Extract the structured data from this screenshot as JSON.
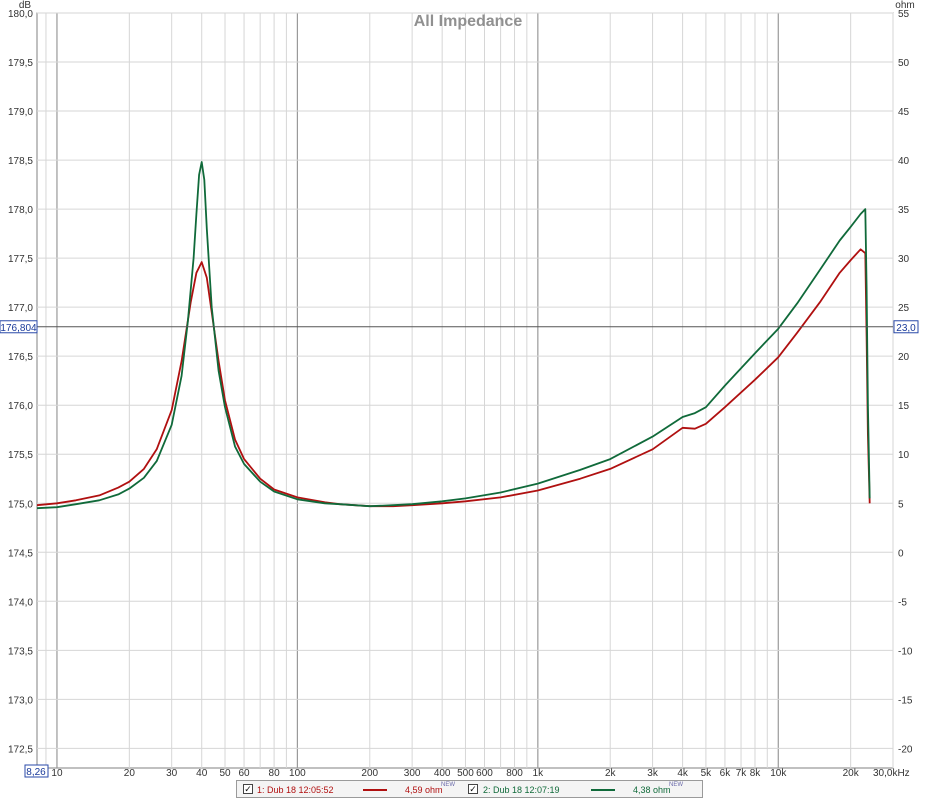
{
  "chart_data": {
    "type": "line",
    "title": "All Impedance",
    "x_scale": "log",
    "xlim": [
      8.26,
      30000
    ],
    "x_ticks": [
      10,
      20,
      30,
      40,
      50,
      60,
      80,
      100,
      200,
      300,
      400,
      500,
      600,
      800,
      1000,
      2000,
      3000,
      4000,
      5000,
      6000,
      7000,
      8000,
      10000,
      20000,
      30000
    ],
    "x_tick_labels": [
      "10",
      "20",
      "30",
      "40",
      "50",
      "60",
      "80",
      "100",
      "200",
      "300",
      "400",
      "500",
      "600",
      "800",
      "1k",
      "2k",
      "3k",
      "4k",
      "5k",
      "6k",
      "7k",
      "8k",
      "10k",
      "20k",
      "30,0kHz"
    ],
    "x_start_label": "8,26",
    "y_left_unit": "dB",
    "ylim_left": [
      172.3,
      180.0
    ],
    "y_left_ticks": [
      172.5,
      173.0,
      173.5,
      174.0,
      174.5,
      175.0,
      175.5,
      176.0,
      176.5,
      177.0,
      177.5,
      178.0,
      178.5,
      179.0,
      179.5,
      180.0
    ],
    "y_left_tick_labels": [
      "172,5",
      "173,0",
      "173,5",
      "174,0",
      "174,5",
      "175,0",
      "175,5",
      "176,0",
      "176,5",
      "177,0",
      "177,5",
      "178,0",
      "178,5",
      "179,0",
      "179,5",
      "180,0"
    ],
    "y_right_unit": "ohm",
    "ylim_right": [
      -22,
      55
    ],
    "y_right_ticks": [
      -20,
      -15,
      -10,
      -5,
      0,
      5,
      10,
      15,
      20,
      25,
      30,
      35,
      40,
      45,
      50,
      55
    ],
    "cursor": {
      "left_label": "176,804",
      "right_label": "23,0",
      "ohm": 23.0
    },
    "grid": true,
    "series": [
      {
        "name": "1: Dub 18 12:05:52",
        "value_label": "4,59 ohm",
        "color": "#b01010",
        "x": [
          8.26,
          10,
          12,
          15,
          18,
          20,
          23,
          26,
          30,
          33,
          36,
          38,
          40,
          42,
          44,
          47,
          50,
          55,
          60,
          70,
          80,
          100,
          130,
          150,
          200,
          250,
          300,
          400,
          500,
          700,
          1000,
          1500,
          2000,
          3000,
          4000,
          4500,
          5000,
          6000,
          8000,
          10000,
          12000,
          15000,
          18000,
          20000,
          22000,
          23000,
          23300,
          23600,
          24000
        ],
        "y": [
          4.8,
          5.0,
          5.3,
          5.8,
          6.6,
          7.2,
          8.5,
          10.5,
          14.5,
          19.5,
          25.5,
          28.5,
          29.6,
          28.0,
          24.5,
          19.5,
          15.5,
          11.5,
          9.5,
          7.5,
          6.4,
          5.6,
          5.1,
          4.9,
          4.7,
          4.7,
          4.8,
          5.0,
          5.2,
          5.6,
          6.3,
          7.5,
          8.5,
          10.5,
          12.7,
          12.6,
          13.1,
          14.8,
          17.6,
          19.9,
          22.4,
          25.6,
          28.5,
          29.8,
          30.9,
          30.5,
          22.0,
          12.0,
          5.0
        ]
      },
      {
        "name": "2: Dub 18 12:07:19",
        "value_label": "4,38 ohm",
        "color": "#106a3a",
        "x": [
          8.26,
          10,
          12,
          15,
          18,
          20,
          23,
          26,
          30,
          33,
          35,
          37,
          38,
          39,
          40,
          41,
          42,
          44,
          47,
          50,
          55,
          60,
          70,
          80,
          100,
          130,
          150,
          200,
          250,
          300,
          400,
          500,
          700,
          1000,
          1500,
          2000,
          3000,
          4000,
          4500,
          5000,
          6000,
          8000,
          10000,
          12000,
          15000,
          18000,
          20000,
          22000,
          23000,
          23300,
          23600,
          24000
        ],
        "y": [
          4.5,
          4.6,
          4.9,
          5.3,
          5.9,
          6.5,
          7.6,
          9.3,
          13.0,
          18.0,
          23.5,
          30.0,
          34.5,
          38.5,
          39.8,
          38.0,
          33.0,
          25.0,
          18.5,
          14.8,
          10.8,
          9.0,
          7.2,
          6.2,
          5.4,
          5.0,
          4.9,
          4.7,
          4.8,
          4.9,
          5.2,
          5.5,
          6.1,
          7.0,
          8.4,
          9.5,
          11.8,
          13.8,
          14.2,
          14.8,
          17.0,
          20.3,
          22.8,
          25.4,
          28.9,
          31.8,
          33.2,
          34.5,
          35.0,
          27.0,
          15.0,
          5.5
        ]
      }
    ]
  }
}
